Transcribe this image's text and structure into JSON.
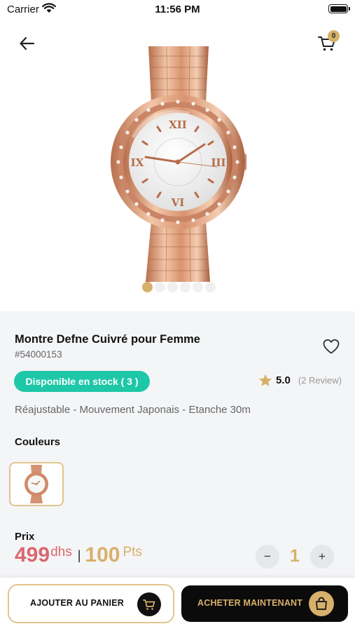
{
  "status_bar": {
    "carrier": "Carrier",
    "time": "11:56 PM"
  },
  "header": {
    "cart_count": "0",
    "carousel": {
      "total": 6,
      "active_index": 0
    }
  },
  "product": {
    "title": "Montre Defne Cuivré pour Femme",
    "sku": "#54000153",
    "stock_label": "Disponible en stock ( 3 )",
    "rating": "5.0",
    "review_count": "(2 Review)",
    "features": "Réajustable - Mouvement Japonais - Etanche 30m",
    "colors_label": "Couleurs",
    "price_label": "Prix",
    "price": "499",
    "currency": "dhs",
    "separator": "|",
    "points": "100",
    "points_unit": "Pts",
    "quantity": "1",
    "qty_minus": "−",
    "qty_plus": "+"
  },
  "actions": {
    "add_to_cart": "AJOUTER AU PANIER",
    "buy_now": "ACHETER MAINTENANT"
  },
  "colors": {
    "accent_gold": "#d7b06b",
    "stock_green": "#1ec7a8",
    "price_red": "#d9686e",
    "background_panel": "#f4f5f7"
  },
  "icons": {
    "back": "arrow-left-icon",
    "cart": "cart-icon",
    "favorite": "heart-icon",
    "rating": "star-icon",
    "add_to_cart": "cart-icon",
    "buy_now": "shopping-bag-icon"
  }
}
